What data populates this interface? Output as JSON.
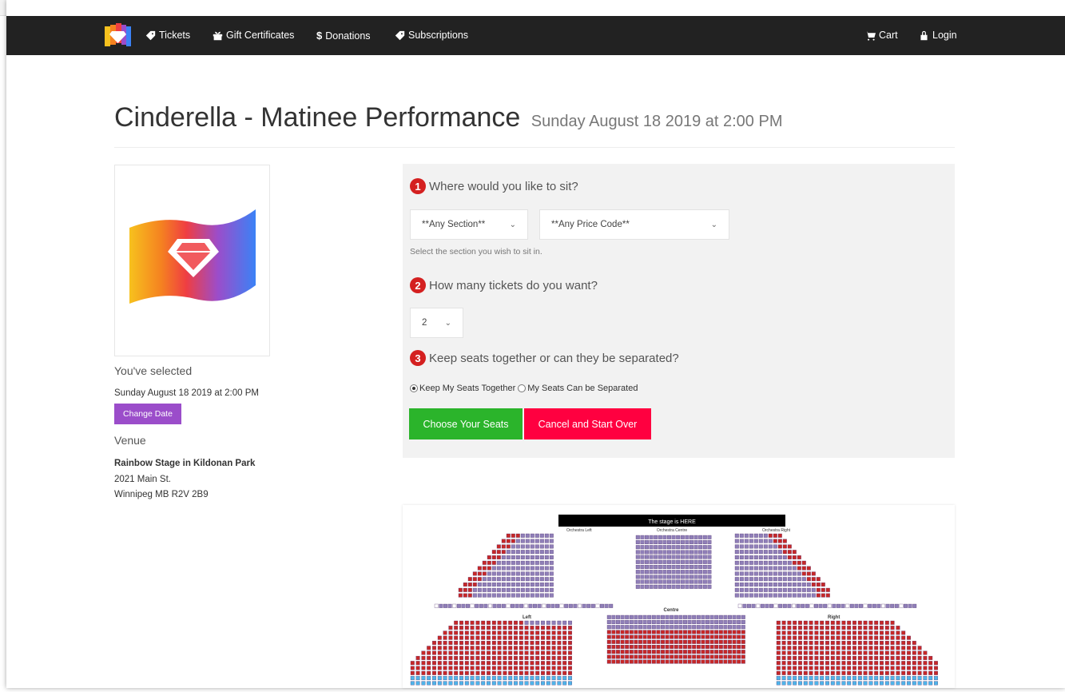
{
  "nav": {
    "items": [
      {
        "label": "Tickets",
        "icon": "tag-icon"
      },
      {
        "label": "Gift Certificates",
        "icon": "gift-icon"
      },
      {
        "label": "Donations",
        "icon": "dollar-icon"
      },
      {
        "label": "Subscriptions",
        "icon": "tag-icon"
      }
    ],
    "cart": "Cart",
    "login": "Login"
  },
  "event": {
    "title": "Cinderella - Matinee Performance",
    "datetime": "Sunday August 18 2019 at 2:00 PM"
  },
  "sidebar": {
    "selected_label": "You've selected",
    "selected_value": "Sunday August 18 2019 at 2:00 PM",
    "change_date": "Change Date",
    "venue_label": "Venue",
    "venue_name": "Rainbow Stage in Kildonan Park",
    "address1": "2021 Main St.",
    "address2": "Winnipeg MB R2V 2B9"
  },
  "form": {
    "step1": {
      "num": "1",
      "question": "Where would you like to sit?"
    },
    "section_select": "**Any Section**",
    "price_select": "**Any Price Code**",
    "section_hint": "Select the section you wish to sit in.",
    "step2": {
      "num": "2",
      "question": "How many tickets do you want?"
    },
    "quantity": "2",
    "step3": {
      "num": "3",
      "question": "Keep seats together or can they be separated?"
    },
    "radio_together": "Keep My Seats Together",
    "radio_separate": "My Seats Can be Separated",
    "choose_button": "Choose Your Seats",
    "cancel_button": "Cancel and Start Over"
  },
  "seatmap": {
    "stage": "The stage is HERE",
    "sections": [
      "Orchestra Left",
      "Orchestra Centre",
      "Orchestra Right",
      "Left",
      "Centre",
      "Right"
    ]
  },
  "colors": {
    "nav": "#222222",
    "purple": "#9b4dca",
    "green": "#2bb42b",
    "red": "#ff0040",
    "step": "#d42020"
  }
}
